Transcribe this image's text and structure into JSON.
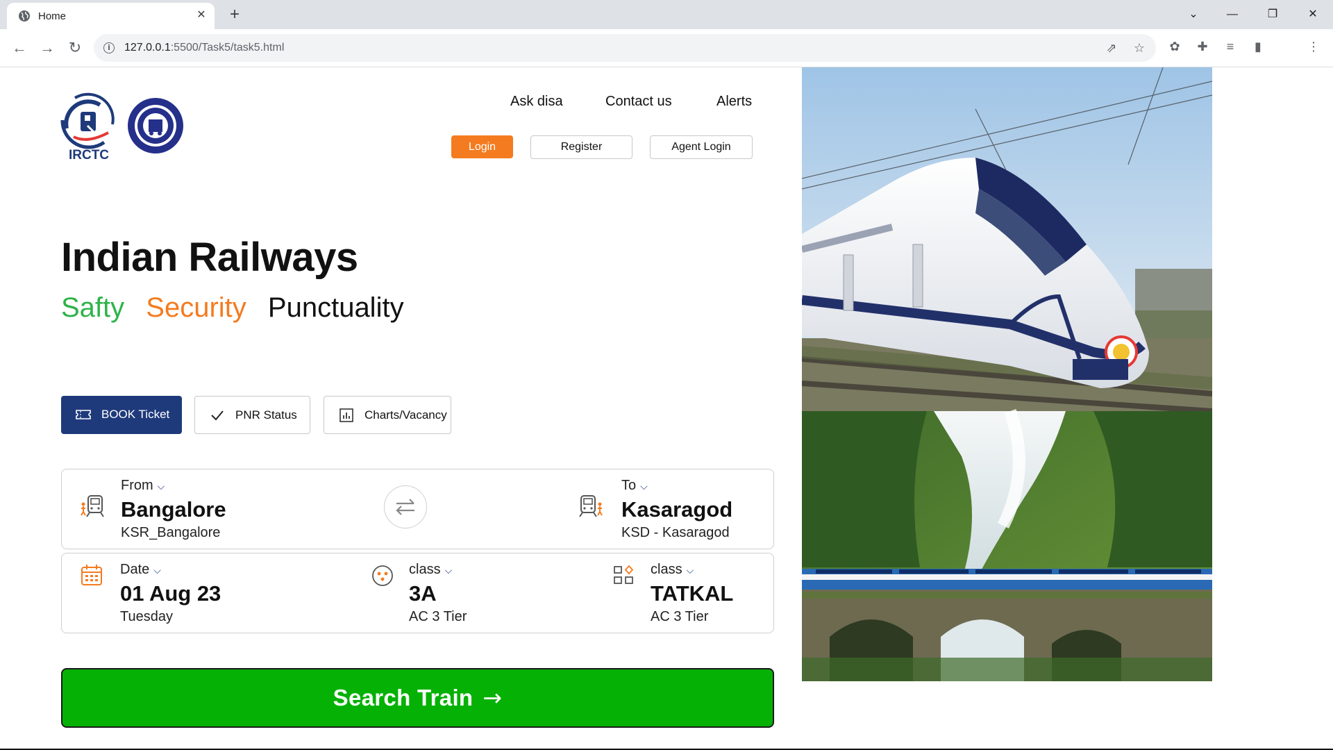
{
  "browser": {
    "tab_title": "Home",
    "url_host": "127.0.0.1",
    "url_path": ":5500/Task5/task5.html"
  },
  "header": {
    "logo_text": "IRCTC",
    "nav_links": [
      "Ask disa",
      "Contact us",
      "Alerts"
    ],
    "login_label": "Login",
    "register_label": "Register",
    "agent_login_label": "Agent Login"
  },
  "hero": {
    "title": "Indian Railways",
    "tagline": [
      "Safty",
      "Security",
      "Punctuality"
    ]
  },
  "tabs": {
    "book": "BOOK Ticket",
    "pnr": "PNR Status",
    "charts": "Charts/Vacancy"
  },
  "journey": {
    "from_caption": "From",
    "from_city": "Bangalore",
    "from_code": "KSR_Bangalore",
    "to_caption": "To",
    "to_city": "Kasaragod",
    "to_code": "KSD - Kasaragod"
  },
  "details": {
    "date_caption": "Date",
    "date_value": "01 Aug 23",
    "day": "Tuesday",
    "class_caption": "class",
    "class_value": "3A",
    "class_sub": "AC 3 Tier",
    "quota_caption": "class",
    "quota_value": "TATKAL",
    "quota_sub": "AC 3 Tier"
  },
  "search_label": "Search Train",
  "colors": {
    "brand_blue": "#1e3a7b",
    "accent_orange": "#f47b20",
    "safety_green": "#2db34a",
    "search_green": "#05b105"
  },
  "icons": [
    "globe-icon",
    "close-icon",
    "plus-icon",
    "back-icon",
    "forward-icon",
    "reload-icon",
    "info-icon",
    "share-icon",
    "star-icon",
    "extension-icon",
    "puzzle-icon",
    "media-icon",
    "sidepanel-icon",
    "menu-icon",
    "ticket-icon",
    "check-icon",
    "chart-icon",
    "station-icon",
    "swap-icon",
    "calendar-icon",
    "seat-class-icon",
    "quota-icon",
    "arrow-right-icon"
  ]
}
